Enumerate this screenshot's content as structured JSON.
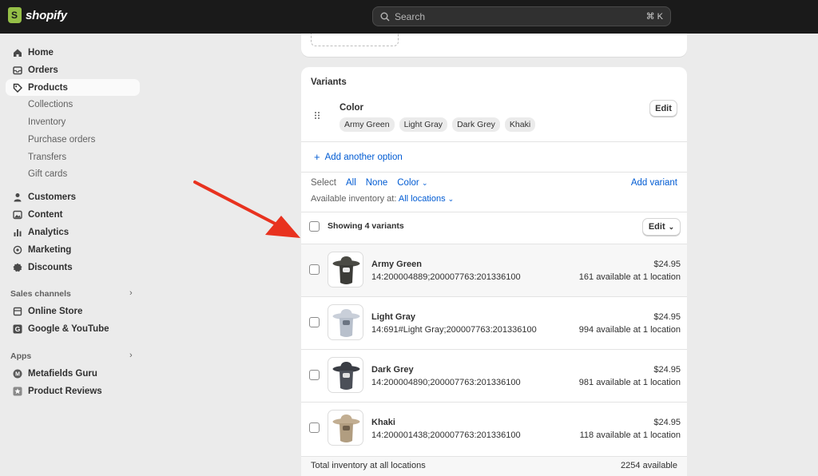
{
  "topbar": {
    "brand": "shopify",
    "search": {
      "placeholder": "Search",
      "shortcut": "⌘ K",
      "icon": "search-icon"
    }
  },
  "sidebar": {
    "items": [
      {
        "label": "Home",
        "icon": "home-icon"
      },
      {
        "label": "Orders",
        "icon": "inbox-icon"
      },
      {
        "label": "Products",
        "icon": "tag-icon",
        "active": true
      }
    ],
    "product_subitems": [
      "Collections",
      "Inventory",
      "Purchase orders",
      "Transfers",
      "Gift cards"
    ],
    "items2": [
      {
        "label": "Customers",
        "icon": "person-icon"
      },
      {
        "label": "Content",
        "icon": "image-icon"
      },
      {
        "label": "Analytics",
        "icon": "bar-chart-icon"
      },
      {
        "label": "Marketing",
        "icon": "target-icon"
      },
      {
        "label": "Discounts",
        "icon": "discount-icon"
      }
    ],
    "sales_channels": {
      "heading": "Sales channels",
      "items": [
        {
          "label": "Online Store",
          "icon": "store-icon"
        },
        {
          "label": "Google & YouTube",
          "icon": "google-icon"
        }
      ]
    },
    "apps": {
      "heading": "Apps",
      "items": [
        {
          "label": "Metafields Guru",
          "icon": "metafields-icon"
        },
        {
          "label": "Product Reviews",
          "icon": "star-icon"
        }
      ]
    }
  },
  "variants": {
    "title": "Variants",
    "option": {
      "name": "Color",
      "values": [
        "Army Green",
        "Light Gray",
        "Dark Grey",
        "Khaki"
      ],
      "edit_label": "Edit"
    },
    "add_option_label": "Add another option",
    "select": {
      "label": "Select",
      "all": "All",
      "none": "None",
      "color": "Color"
    },
    "add_variant_label": "Add variant",
    "inventory_prefix": "Available inventory at:",
    "inventory_location": "All locations",
    "showing_label": "Showing 4 variants",
    "bulk_edit_label": "Edit",
    "rows": [
      {
        "name": "Army Green",
        "sku": "14:200004889;200007763:201336100",
        "price": "$24.95",
        "availability": "161 available at 1 location",
        "hat_color": "#4a4a44"
      },
      {
        "name": "Light Gray",
        "sku": "14:691#Light Gray;200007763:201336100",
        "price": "$24.95",
        "availability": "994 available at 1 location",
        "hat_color": "#c9cfd9"
      },
      {
        "name": "Dark Grey",
        "sku": "14:200004890;200007763:201336100",
        "price": "$24.95",
        "availability": "981 available at 1 location",
        "hat_color": "#3a3d44"
      },
      {
        "name": "Khaki",
        "sku": "14:200001438;200007763:201336100",
        "price": "$24.95",
        "availability": "118 available at 1 location",
        "hat_color": "#c2ae92"
      }
    ],
    "total_label": "Total inventory at all locations",
    "total_value": "2254 available"
  },
  "annotation_color": "#e8321f"
}
